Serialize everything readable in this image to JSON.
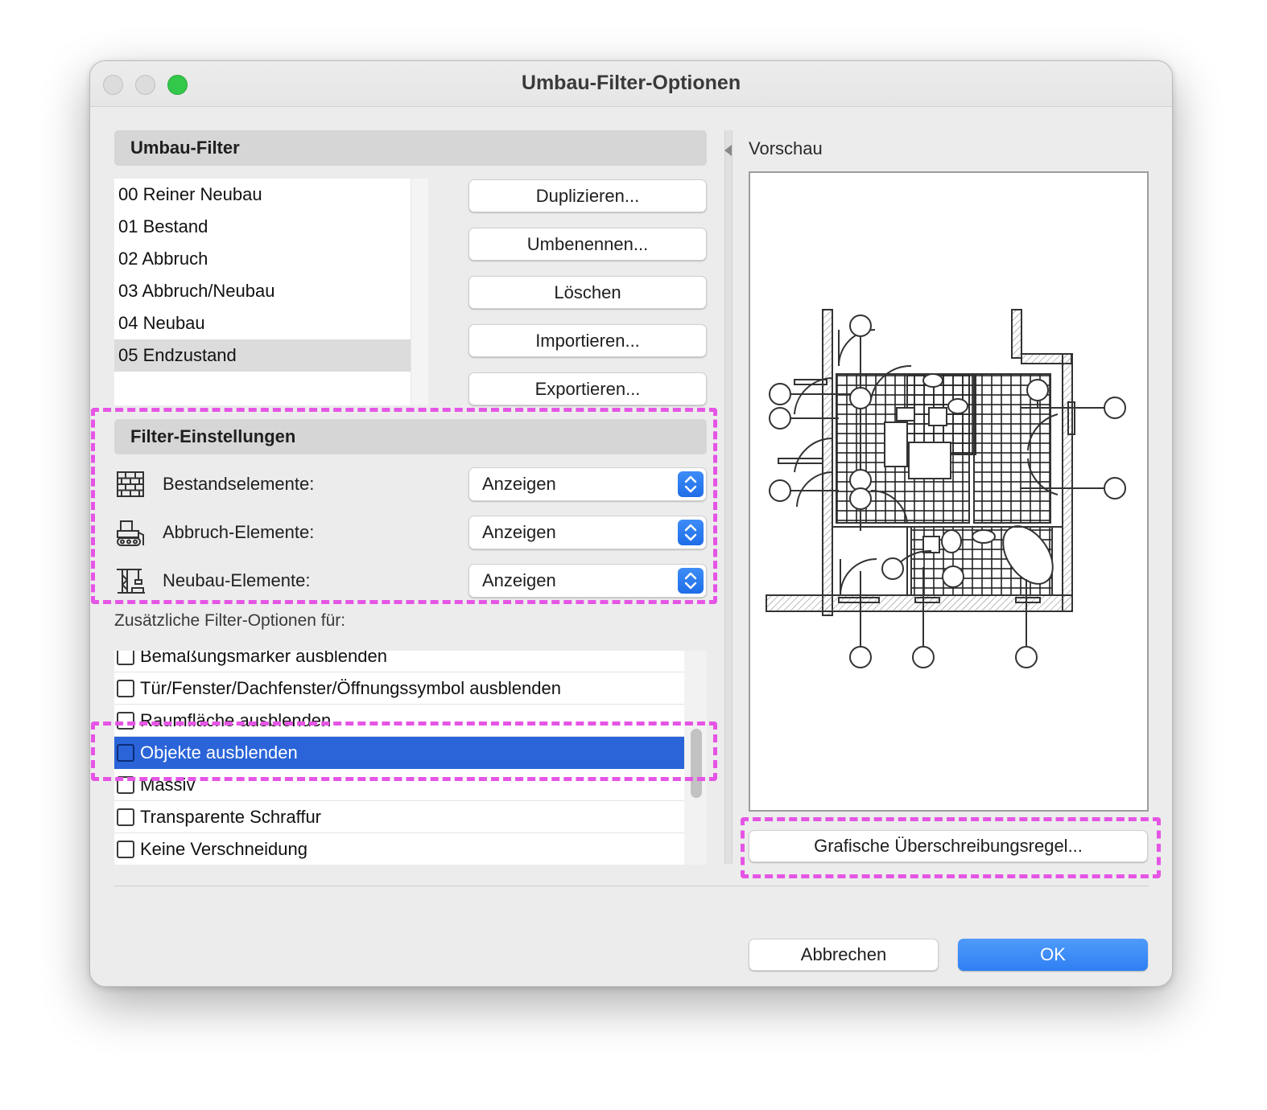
{
  "window": {
    "title": "Umbau-Filter-Optionen"
  },
  "umbau_filter": {
    "header": "Umbau-Filter",
    "items": [
      {
        "label": "00 Reiner Neubau",
        "selected": false
      },
      {
        "label": "01 Bestand",
        "selected": false
      },
      {
        "label": "02 Abbruch",
        "selected": false
      },
      {
        "label": "03 Abbruch/Neubau",
        "selected": false
      },
      {
        "label": "04 Neubau",
        "selected": false
      },
      {
        "label": "05 Endzustand",
        "selected": true
      }
    ],
    "buttons": {
      "duplicate": "Duplizieren...",
      "rename": "Umbenennen...",
      "delete": "Löschen",
      "import": "Importieren...",
      "export": "Exportieren..."
    }
  },
  "filter_settings": {
    "header": "Filter-Einstellungen",
    "rows": [
      {
        "label": "Bestandselemente:",
        "value": "Anzeigen",
        "icon": "brick-wall-icon"
      },
      {
        "label": "Abbruch-Elemente:",
        "value": "Anzeigen",
        "icon": "bulldozer-icon"
      },
      {
        "label": "Neubau-Elemente:",
        "value": "Anzeigen",
        "icon": "crane-icon"
      }
    ]
  },
  "additional_options": {
    "label": "Zusätzliche Filter-Optionen für:",
    "items": [
      {
        "label": "Bemaßungsmarker ausblenden",
        "checked": false,
        "selected": false
      },
      {
        "label": "Tür/Fenster/Dachfenster/Öffnungssymbol ausblenden",
        "checked": false,
        "selected": false
      },
      {
        "label": "Raumfläche ausblenden",
        "checked": false,
        "selected": false
      },
      {
        "label": "Objekte ausblenden",
        "checked": false,
        "selected": true
      },
      {
        "label": "Massiv",
        "checked": false,
        "selected": false
      },
      {
        "label": "Transparente Schraffur",
        "checked": false,
        "selected": false
      },
      {
        "label": "Keine Verschneidung",
        "checked": false,
        "selected": false
      }
    ]
  },
  "preview": {
    "label": "Vorschau",
    "override_button": "Grafische Überschreibungsregel..."
  },
  "footer": {
    "cancel": "Abbrechen",
    "ok": "OK"
  },
  "colors": {
    "accent": "#2f7ff4",
    "selection": "#2a64d8",
    "highlight_annotation": "#e555e5"
  }
}
